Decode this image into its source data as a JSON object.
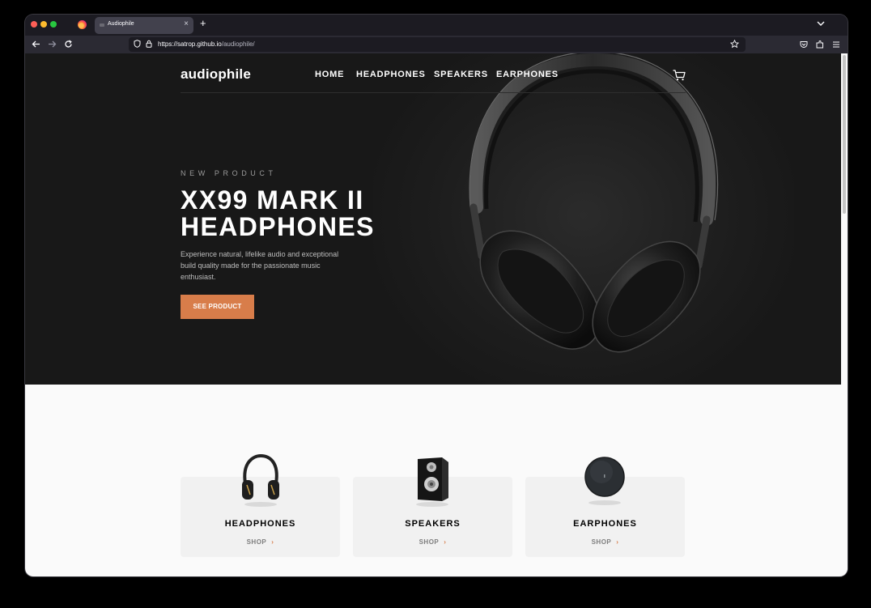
{
  "browser": {
    "tab_title": "Audiophile",
    "tab_close": "×",
    "new_tab": "+",
    "url_host": "https://satrop.github.io",
    "url_path": "/audiophile/"
  },
  "site": {
    "logo": "audiophile",
    "nav": [
      "HOME",
      "HEADPHONES",
      "SPEAKERS",
      "EARPHONES"
    ]
  },
  "hero": {
    "overline": "NEW PRODUCT",
    "headline": "XX99 MARK II\nHEADPHONES",
    "description": "Experience natural, lifelike audio and exceptional build quality made for the passionate music enthusiast.",
    "cta": "SEE PRODUCT"
  },
  "categories": [
    {
      "title": "HEADPHONES",
      "shop": "SHOP"
    },
    {
      "title": "SPEAKERS",
      "shop": "SHOP"
    },
    {
      "title": "EARPHONES",
      "shop": "SHOP"
    }
  ],
  "colors": {
    "accent": "#D87D4A",
    "hero_bg": "#181818",
    "page_bg": "#FAFAFA",
    "card_bg": "#F1F1F1"
  },
  "icons": [
    "back-arrow-icon",
    "forward-arrow-icon",
    "reload-icon",
    "shield-icon",
    "lock-icon",
    "star-icon",
    "pocket-icon",
    "extensions-icon",
    "menu-icon",
    "cart-icon",
    "chevron-right-icon"
  ]
}
